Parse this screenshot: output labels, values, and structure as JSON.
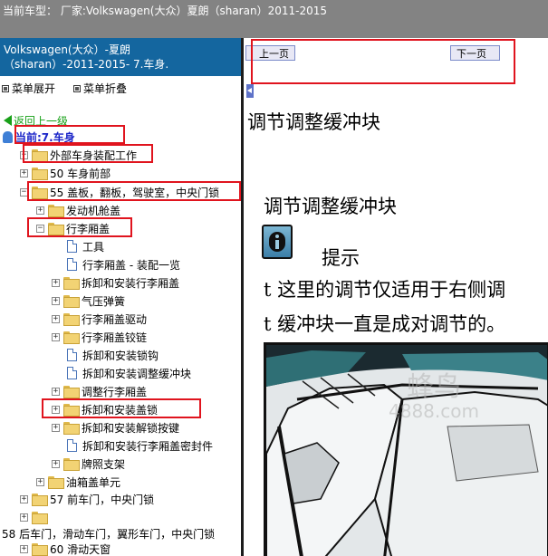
{
  "header": {
    "title": "当前车型：  厂家:Volkswagen(大众）夏朗（sharan）2011-2015"
  },
  "sidebar": {
    "heading_line1": "Volkswagen(大众）-夏朗",
    "heading_line2": "（sharan）-2011-2015- 7.车身.",
    "expand_label": "菜单展开",
    "collapse_label": "菜单折叠",
    "back_label": "返回上一级",
    "current_label": "当前:7.车身"
  },
  "tree": {
    "n1": "外部车身装配工作",
    "n2": "50 车身前部",
    "n3": "55 盖板，翻板，驾驶室，中央门锁",
    "n4": "发动机舱盖",
    "n5": "行李厢盖",
    "n6": "工具",
    "n7": "行李厢盖 - 装配一览",
    "n8": "拆卸和安装行李厢盖",
    "n9": "气压弹簧",
    "n10": "行李厢盖驱动",
    "n11": "行李厢盖铰链",
    "n12": "拆卸和安装锁钩",
    "n13": "拆卸和安装调整缓冲块",
    "n14": "调整行李厢盖",
    "n15": "拆卸和安装盖锁",
    "n16": "拆卸和安装解锁按键",
    "n17": "拆卸和安装行李厢盖密封件",
    "n18": "牌照支架",
    "n19": "油箱盖单元",
    "n20": "57 前车门，中央门锁",
    "n21": "",
    "n22": "58 后车门，滑动车门，翼形车门，中央门锁",
    "n23": "60 滑动天窗"
  },
  "content": {
    "prev_label": "上一页",
    "next_label": "下一页",
    "heading": "调节调整缓冲块",
    "subheading": "调节调整缓冲块",
    "note_label": "提示",
    "line1": "t 这里的调节仅适用于右侧调",
    "line2": "t 缓冲块一直是成对调节的。",
    "watermark_main": "蜂鸟",
    "watermark_site": "4888.com"
  },
  "colors": {
    "accent_blue": "#14669f",
    "highlight_red": "#e0141e",
    "titlebar_gray": "#838383",
    "back_green": "#14a014",
    "current_blue": "#1a24c8"
  }
}
